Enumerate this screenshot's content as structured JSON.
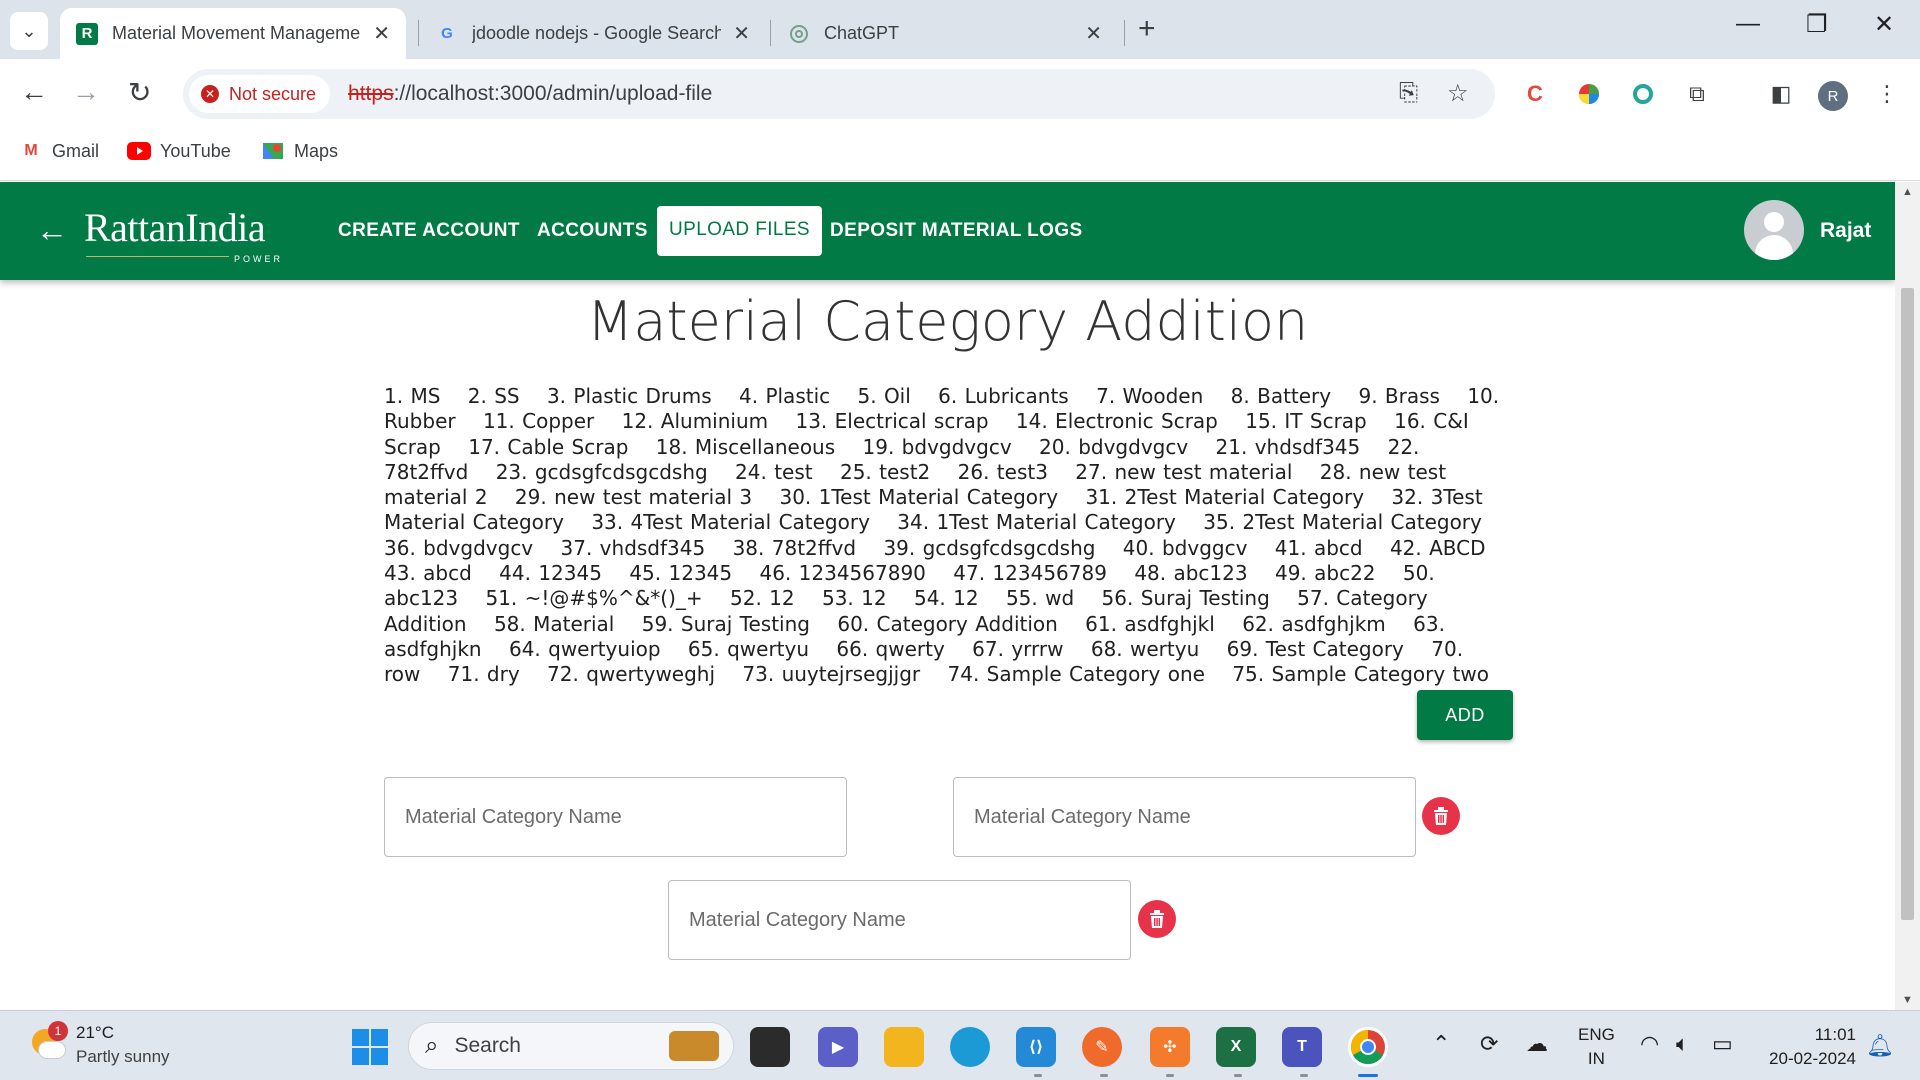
{
  "browser": {
    "tabs": [
      {
        "title": "Material Movement Manageme",
        "favicon": "R"
      },
      {
        "title": "jdoodle nodejs - Google Search",
        "favicon": "G"
      },
      {
        "title": "ChatGPT",
        "favicon": "chatgpt-icon"
      }
    ],
    "security_label": "Not secure",
    "url_scheme": "https",
    "url_rest": "://localhost:3000/admin/upload-file",
    "bookmarks": [
      {
        "label": "Gmail",
        "icon": "M"
      },
      {
        "label": "YouTube",
        "icon": "youtube-icon"
      },
      {
        "label": "Maps",
        "icon": "maps-icon"
      }
    ],
    "profile_initial": "R"
  },
  "header": {
    "logo_text": "RattanIndia",
    "logo_sub": "POWER",
    "menu": [
      "CREATE ACCOUNT",
      "ACCOUNTS",
      "UPLOAD FILES",
      "DEPOSIT MATERIAL LOGS"
    ],
    "active_menu": "UPLOAD FILES",
    "user_name": "Rajat"
  },
  "main": {
    "title": "Material Category Addition",
    "categories": [
      "1. MS",
      "2. SS",
      "3. Plastic Drums",
      "4. Plastic",
      "5. Oil",
      "6. Lubricants",
      "7. Wooden",
      "8. Battery",
      "9. Brass",
      "10. Rubber",
      "11. Copper",
      "12. Aluminium",
      "13. Electrical scrap",
      "14. Electronic Scrap",
      "15. IT Scrap",
      "16. C&I Scrap",
      "17. Cable Scrap",
      "18. Miscellaneous",
      "19. bdvgdvgcv",
      "20. bdvgdvgcv",
      "21. vhdsdf345",
      "22. 78t2ffvd",
      "23. gcdsgfcdsgcdshg",
      "24. test",
      "25. test2",
      "26. test3",
      "27. new test material",
      "28. new test material 2",
      "29. new test material 3",
      "30. 1Test Material Category",
      "31. 2Test Material Category",
      "32. 3Test Material Category",
      "33. 4Test Material Category",
      "34. 1Test Material Category",
      "35. 2Test Material Category",
      "36. bdvgdvgcv",
      "37. vhdsdf345",
      "38. 78t2ffvd",
      "39. gcdsgfcdsgcdshg",
      "40. bdvggcv",
      "41. abcd",
      "42. ABCD",
      "43. abcd",
      "44. 12345",
      "45. 12345",
      "46. 1234567890",
      "47. 123456789",
      "48. abc123",
      "49. abc22",
      "50. abc123",
      "51. ~!@#$%^&*()_+",
      "52. 12",
      "53. 12",
      "54. 12",
      "55. wd",
      "56. Suraj Testing",
      "57. Category Addition",
      "58. Material",
      "59. Suraj Testing",
      "60. Category Addition",
      "61. asdfghjkl",
      "62. asdfghjkm",
      "63. asdfghjkn",
      "64. qwertyuiop",
      "65. qwertyu",
      "66. qwerty",
      "67. yrrrw",
      "68. wertyu",
      "69. Test Category",
      "70. row",
      "71. dry",
      "72. qwertyweghj",
      "73. uuytejrsegjjgr",
      "74. Sample Category one",
      "75. Sample Category two"
    ],
    "add_label": "ADD",
    "input_placeholder": "Material Category Name"
  },
  "taskbar": {
    "temperature": "21°C",
    "condition": "Partly sunny",
    "weather_badge": "1",
    "search_label": "Search",
    "lang_line1": "ENG",
    "lang_line2": "IN",
    "time": "11:01",
    "date": "20-02-2024"
  },
  "colors": {
    "brand_green": "#027a45",
    "danger_red": "#e7334a"
  }
}
